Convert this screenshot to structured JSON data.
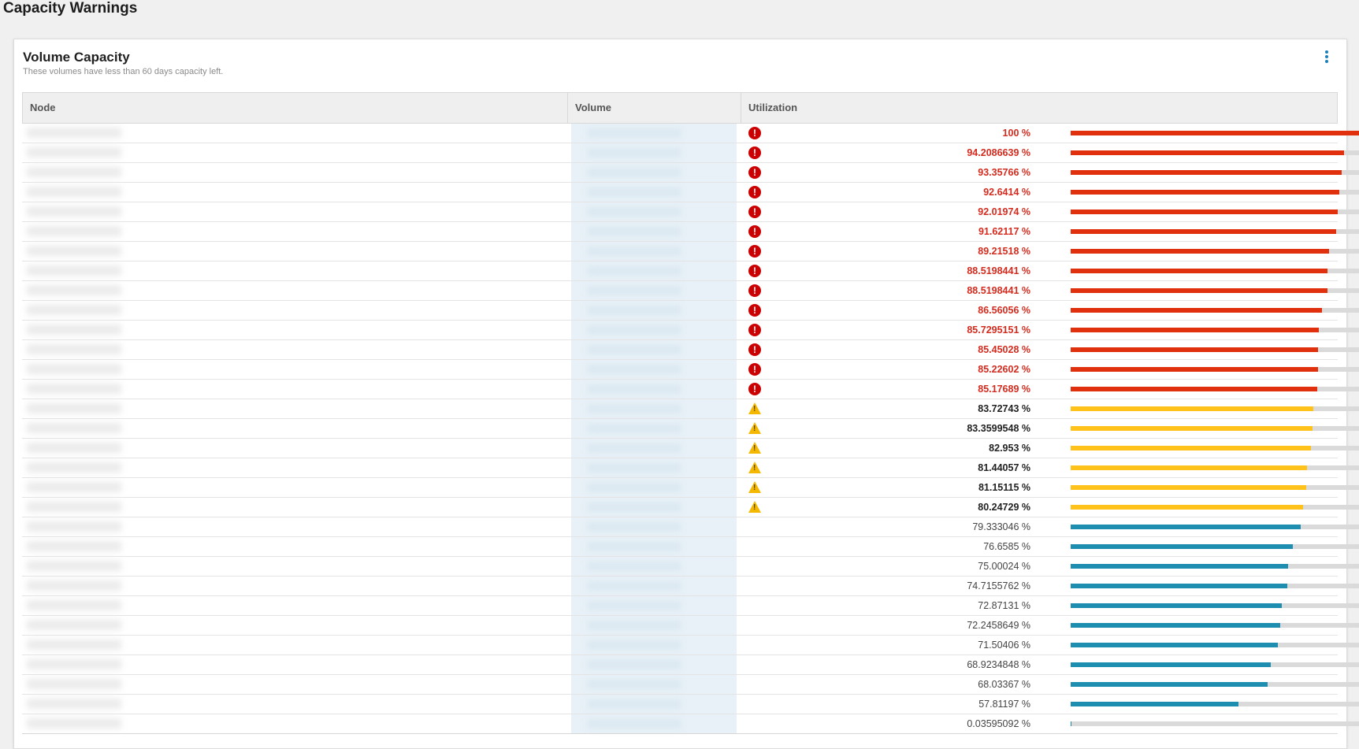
{
  "page": {
    "title": "Capacity Warnings"
  },
  "widget": {
    "title": "Volume Capacity",
    "subtitle": "These volumes have less than 60 days capacity left.",
    "menu_icon": "kebab-vertical-icon"
  },
  "table": {
    "columns": [
      "Node",
      "Volume",
      "Utilization"
    ],
    "colors": {
      "critical": "#e0300e",
      "warning": "#ffc21a",
      "normal": "#1d8db0",
      "track": "#dadada"
    },
    "rows": [
      {
        "value": "100 %",
        "fraction": 1.0,
        "status": "critical"
      },
      {
        "value": "94.2086639 %",
        "fraction": 0.942086639,
        "status": "critical"
      },
      {
        "value": "93.35766 %",
        "fraction": 0.9335766,
        "status": "critical"
      },
      {
        "value": "92.6414 %",
        "fraction": 0.926414,
        "status": "critical"
      },
      {
        "value": "92.01974 %",
        "fraction": 0.9201974,
        "status": "critical"
      },
      {
        "value": "91.62117 %",
        "fraction": 0.9162117,
        "status": "critical"
      },
      {
        "value": "89.21518 %",
        "fraction": 0.8921518,
        "status": "critical"
      },
      {
        "value": "88.5198441 %",
        "fraction": 0.885198441,
        "status": "critical"
      },
      {
        "value": "88.5198441 %",
        "fraction": 0.885198441,
        "status": "critical"
      },
      {
        "value": "86.56056 %",
        "fraction": 0.8656056,
        "status": "critical"
      },
      {
        "value": "85.7295151 %",
        "fraction": 0.857295151,
        "status": "critical"
      },
      {
        "value": "85.45028 %",
        "fraction": 0.8545028,
        "status": "critical"
      },
      {
        "value": "85.22602 %",
        "fraction": 0.8522602,
        "status": "critical"
      },
      {
        "value": "85.17689 %",
        "fraction": 0.8517689,
        "status": "critical"
      },
      {
        "value": "83.72743 %",
        "fraction": 0.8372743,
        "status": "warning"
      },
      {
        "value": "83.3599548 %",
        "fraction": 0.833599548,
        "status": "warning"
      },
      {
        "value": "82.953 %",
        "fraction": 0.82953,
        "status": "warning"
      },
      {
        "value": "81.44057 %",
        "fraction": 0.8144057,
        "status": "warning"
      },
      {
        "value": "81.15115 %",
        "fraction": 0.8115115,
        "status": "warning"
      },
      {
        "value": "80.24729 %",
        "fraction": 0.8024729,
        "status": "warning"
      },
      {
        "value": "79.333046 %",
        "fraction": 0.79333046,
        "status": "normal"
      },
      {
        "value": "76.6585 %",
        "fraction": 0.766585,
        "status": "normal"
      },
      {
        "value": "75.00024 %",
        "fraction": 0.7500024,
        "status": "normal"
      },
      {
        "value": "74.7155762 %",
        "fraction": 0.747155762,
        "status": "normal"
      },
      {
        "value": "72.87131 %",
        "fraction": 0.7287131,
        "status": "normal"
      },
      {
        "value": "72.2458649 %",
        "fraction": 0.722458649,
        "status": "normal"
      },
      {
        "value": "71.50406 %",
        "fraction": 0.7150406,
        "status": "normal"
      },
      {
        "value": "68.9234848 %",
        "fraction": 0.689234848,
        "status": "normal"
      },
      {
        "value": "68.03367 %",
        "fraction": 0.6803367,
        "status": "normal"
      },
      {
        "value": "57.81197 %",
        "fraction": 0.5781197,
        "status": "normal"
      },
      {
        "value": "0.03595092 %",
        "fraction": 0.0003595092,
        "status": "normal"
      }
    ]
  }
}
